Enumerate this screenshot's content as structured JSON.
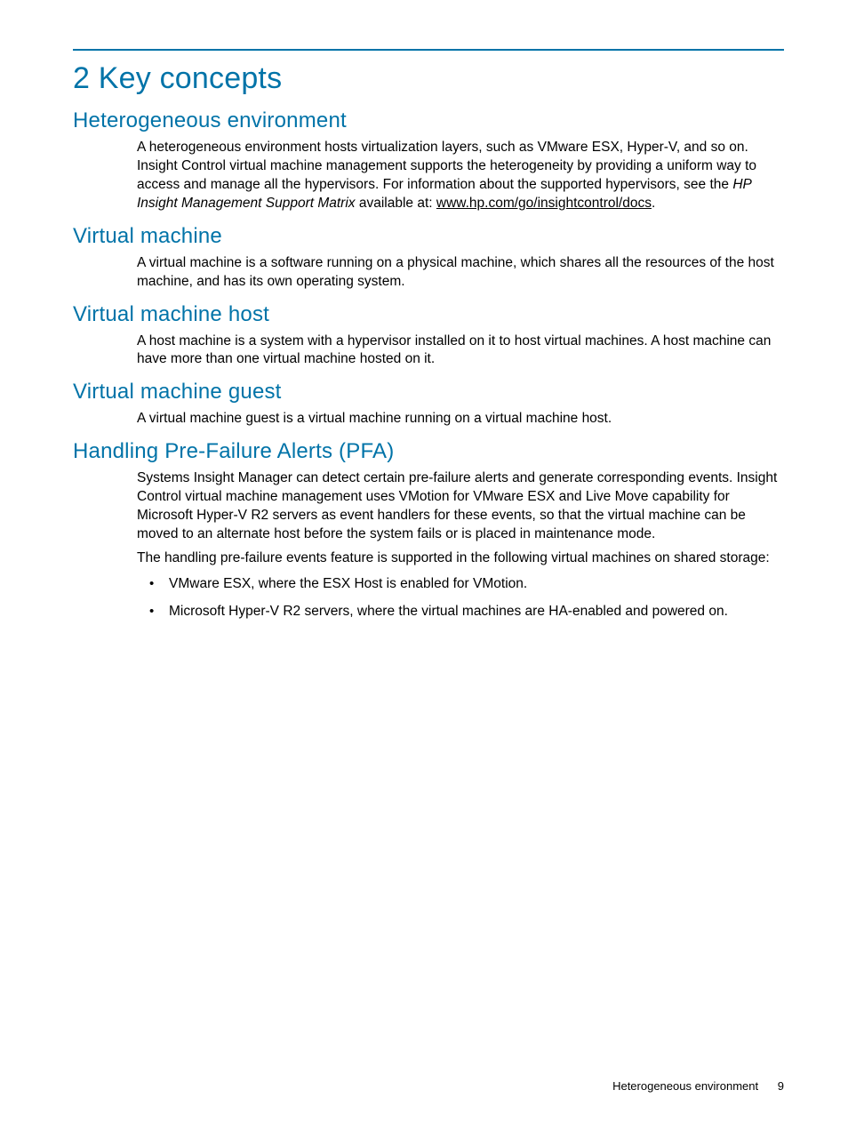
{
  "chapter_title": "2 Key concepts",
  "sections": {
    "hetero": {
      "heading": "Heterogeneous environment",
      "p1_a": "A heterogeneous environment hosts virtualization layers, such as VMware ESX, Hyper-V, and so on. Insight Control virtual machine management supports the heterogeneity by providing a uniform way to access and manage all the hypervisors. For information about the supported hypervisors, see the ",
      "p1_italic": "HP Insight Management Support Matrix",
      "p1_b": "  available at: ",
      "link": "www.hp.com/go/insightcontrol/docs",
      "p1_c": "."
    },
    "vm": {
      "heading": "Virtual machine",
      "p1": "A virtual machine is a software running on a physical machine, which shares all the resources of the host machine, and has its own operating system."
    },
    "vmhost": {
      "heading": "Virtual machine host",
      "p1": "A host machine is a system with a hypervisor installed on it to host virtual machines. A host machine can have more than one virtual machine hosted on it."
    },
    "vmguest": {
      "heading": "Virtual machine guest",
      "p1": "A virtual machine guest is a virtual machine running on a virtual machine host."
    },
    "pfa": {
      "heading": "Handling Pre-Failure Alerts (PFA)",
      "p1": "Systems Insight Manager can detect certain pre-failure alerts and generate corresponding events. Insight Control virtual machine management uses VMotion for VMware ESX and Live Move capability for Microsoft Hyper-V R2 servers as event handlers for these events, so that the virtual machine can be moved to an alternate host before the system fails or is placed in maintenance mode.",
      "p2": "The handling pre-failure events feature is supported in the following virtual machines on shared storage:",
      "bullets": [
        "VMware ESX, where the ESX Host is enabled for VMotion.",
        "Microsoft Hyper-V R2 servers, where the virtual machines are HA-enabled and powered on."
      ]
    }
  },
  "footer": {
    "label": "Heterogeneous environment",
    "page": "9"
  }
}
